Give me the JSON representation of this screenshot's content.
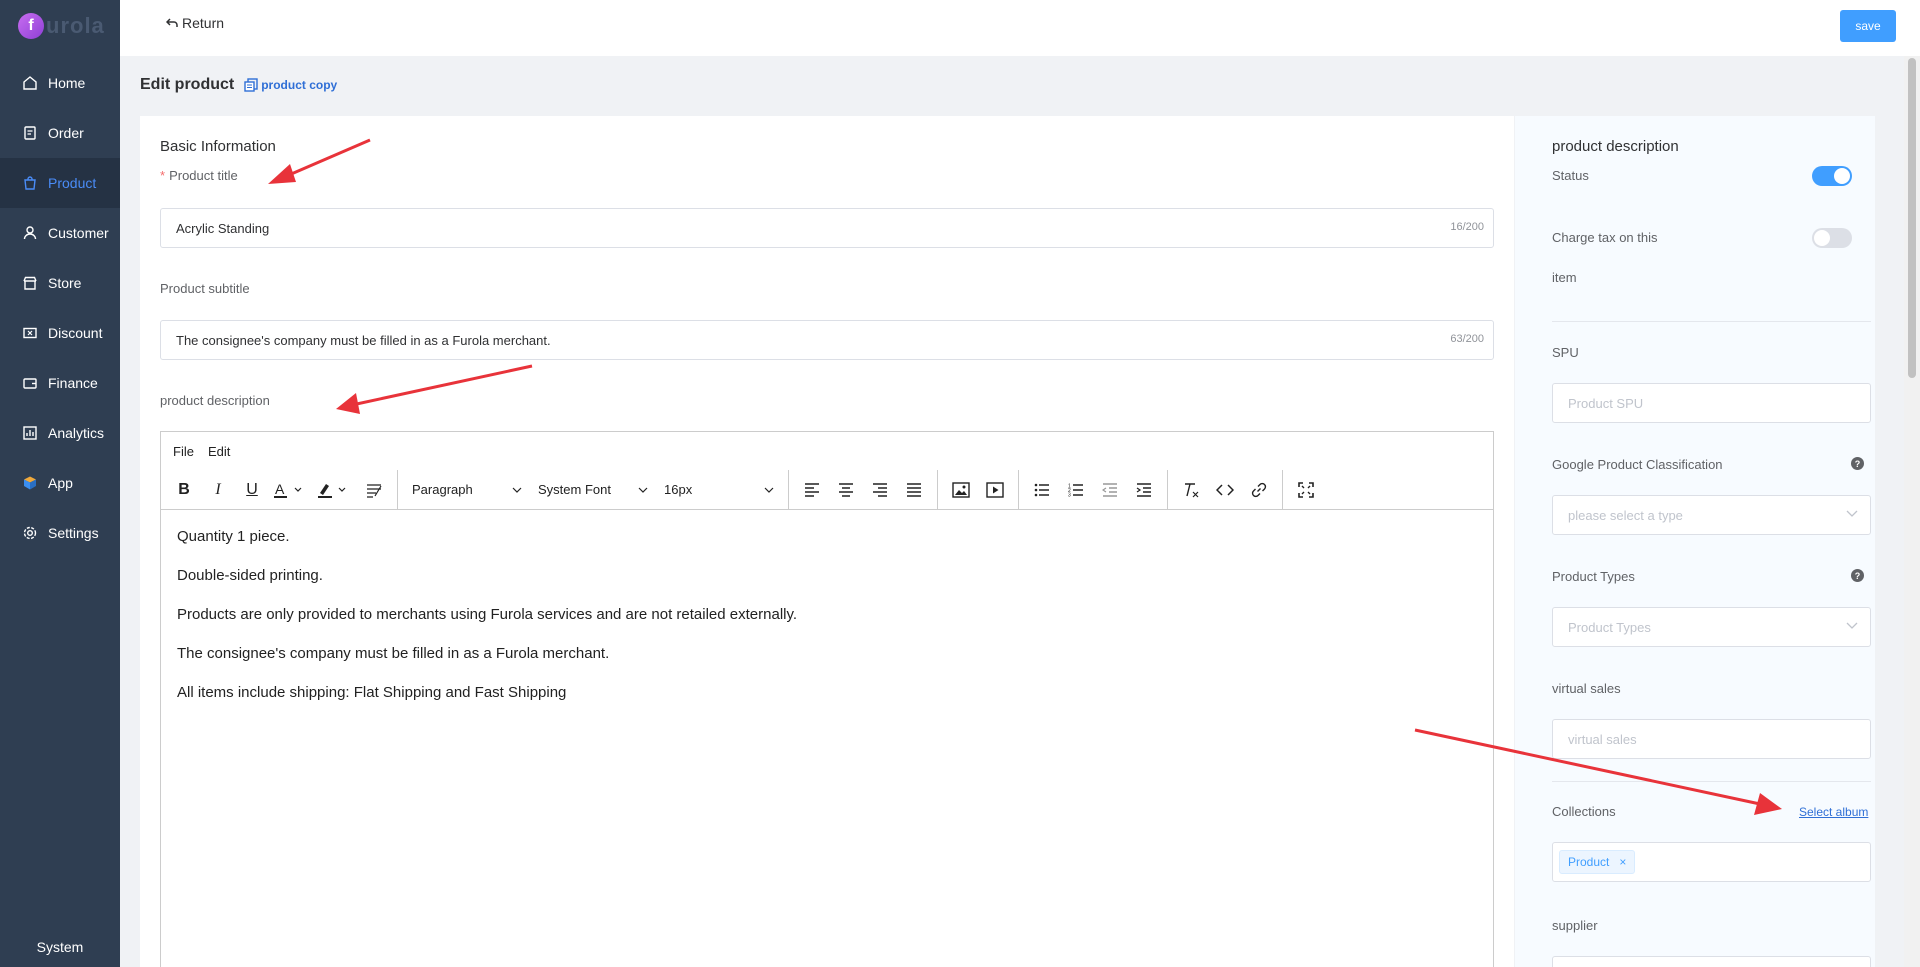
{
  "sidebar": {
    "logo_letter": "f",
    "logo_text": "urola",
    "items": [
      {
        "label": "Home",
        "icon": "home-icon"
      },
      {
        "label": "Order",
        "icon": "order-icon"
      },
      {
        "label": "Product",
        "icon": "bag-icon",
        "active": true
      },
      {
        "label": "Customer",
        "icon": "user-icon"
      },
      {
        "label": "Store",
        "icon": "store-icon"
      },
      {
        "label": "Discount",
        "icon": "ticket-icon"
      },
      {
        "label": "Finance",
        "icon": "wallet-icon"
      },
      {
        "label": "Analytics",
        "icon": "chart-icon"
      },
      {
        "label": "App",
        "icon": "cube-icon"
      },
      {
        "label": "Settings",
        "icon": "gear-icon"
      }
    ],
    "system_label": "System"
  },
  "topbar": {
    "return_label": "Return",
    "save_label": "save"
  },
  "page": {
    "title": "Edit product",
    "copy_link": "product copy"
  },
  "basic": {
    "section_title": "Basic Information",
    "title_label": "Product title",
    "title_value": "Acrylic Standing",
    "title_count": "16/200",
    "subtitle_label": "Product subtitle",
    "subtitle_value": "The consignee's company must be filled in as a Furola merchant.",
    "subtitle_count": "63/200",
    "description_label": "product description"
  },
  "editor": {
    "menu": [
      "File",
      "Edit"
    ],
    "block_format": "Paragraph",
    "font_family": "System Font",
    "font_size": "16px",
    "content": [
      "Quantity 1 piece.",
      "Double-sided printing.",
      "Products are only provided to merchants using Furola services and are not retailed externally.",
      "The consignee's company must be filled in as a Furola merchant.",
      "All items include shipping: Flat Shipping and Fast Shipping"
    ]
  },
  "right": {
    "section_title": "product description",
    "status_label": "Status",
    "status_on": true,
    "tax_label_1": "Charge tax on this",
    "tax_label_2": "item",
    "tax_on": false,
    "spu_label": "SPU",
    "spu_placeholder": "Product SPU",
    "google_label": "Google Product Classification",
    "google_placeholder": "please select a type",
    "types_label": "Product Types",
    "types_placeholder": "Product Types",
    "virtual_label": "virtual sales",
    "virtual_placeholder": "virtual sales",
    "collections_label": "Collections",
    "select_album": "Select album",
    "collection_tag": "Product",
    "tag_remove": "×",
    "supplier_label": "supplier"
  },
  "colors": {
    "sidebar_bg": "#2f3e52",
    "accent": "#409eff",
    "annotation_arrow": "#e8333a"
  }
}
